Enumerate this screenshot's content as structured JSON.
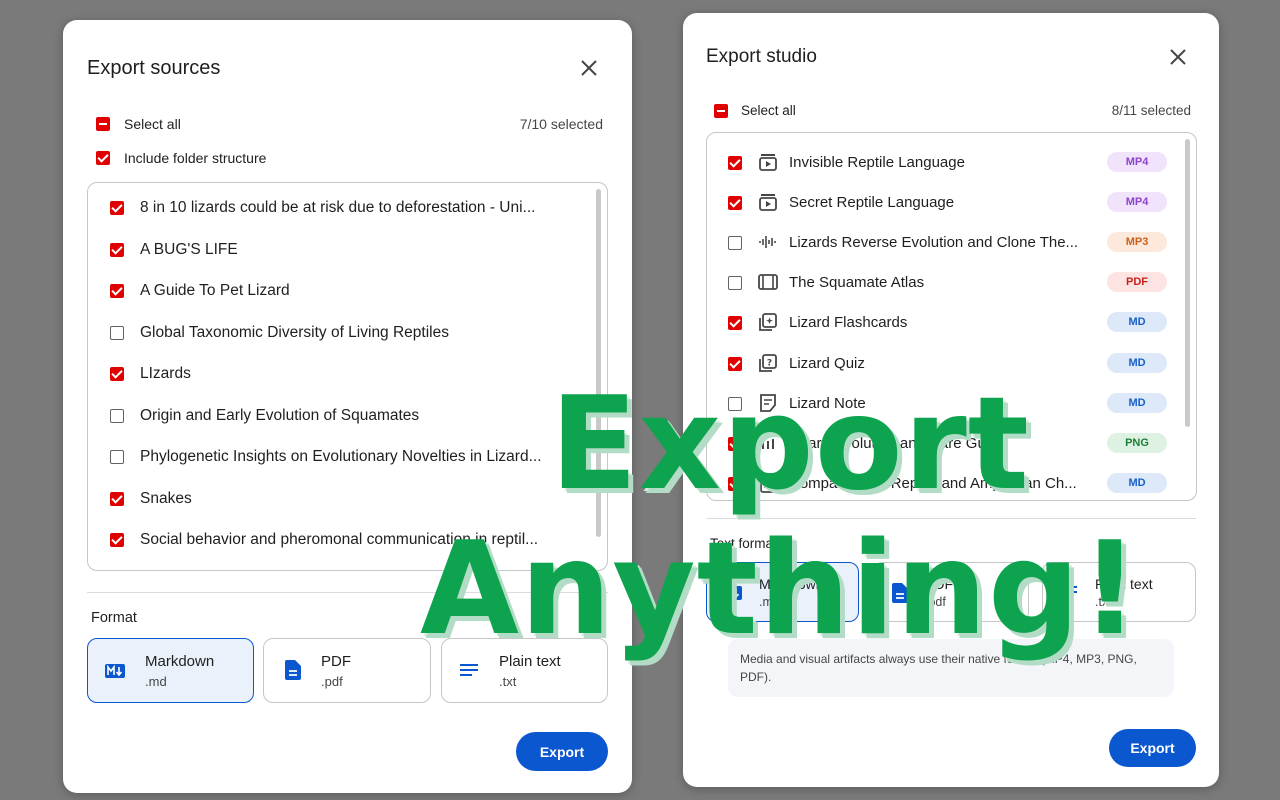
{
  "export_sources": {
    "title": "Export sources",
    "select_all_label": "Select all",
    "selected_count": "7/10 selected",
    "folder_structure_label": "Include folder structure",
    "items": [
      {
        "label": "8 in 10 lizards could be at risk due to deforestation - Uni...",
        "checked": true
      },
      {
        "label": "A BUG'S LIFE",
        "checked": true
      },
      {
        "label": "A Guide To Pet Lizard",
        "checked": true
      },
      {
        "label": "Global Taxonomic Diversity of Living Reptiles",
        "checked": false
      },
      {
        "label": "LIzards",
        "checked": true
      },
      {
        "label": "Origin and Early Evolution of Squamates",
        "checked": false
      },
      {
        "label": "Phylogenetic Insights on Evolutionary Novelties in Lizard...",
        "checked": false
      },
      {
        "label": "Snakes",
        "checked": true
      },
      {
        "label": "Social behavior and pheromonal communication in reptil...",
        "checked": true
      }
    ],
    "format_label": "Format",
    "formats": [
      {
        "name": "Markdown",
        "ext": ".md",
        "icon": "markdown-icon",
        "selected": true
      },
      {
        "name": "PDF",
        "ext": ".pdf",
        "icon": "pdf-doc-icon",
        "selected": false
      },
      {
        "name": "Plain text",
        "ext": ".txt",
        "icon": "text-lines-icon",
        "selected": false
      }
    ],
    "export_label": "Export"
  },
  "export_studio": {
    "title": "Export studio",
    "select_all_label": "Select all",
    "selected_count": "8/11 selected",
    "items": [
      {
        "label": "Invisible Reptile Language",
        "checked": true,
        "icon": "video-overview-icon",
        "badge": "MP4"
      },
      {
        "label": "Secret Reptile Language",
        "checked": true,
        "icon": "video-overview-icon",
        "badge": "MP4"
      },
      {
        "label": "Lizards Reverse Evolution and Clone The...",
        "checked": false,
        "icon": "audio-waveform-icon",
        "badge": "MP3"
      },
      {
        "label": "The Squamate Atlas",
        "checked": false,
        "icon": "slides-icon",
        "badge": "PDF"
      },
      {
        "label": "Lizard Flashcards",
        "checked": true,
        "icon": "flashcards-icon",
        "badge": "MD"
      },
      {
        "label": "Lizard Quiz",
        "checked": true,
        "icon": "quiz-icon",
        "badge": "MD"
      },
      {
        "label": "Lizard Note",
        "checked": false,
        "icon": "note-icon",
        "badge": "MD"
      },
      {
        "label": "Lizard Evolution and Care Guide",
        "checked": true,
        "icon": "infographic-icon",
        "badge": "PNG"
      },
      {
        "label": "Comparison of Reptile and Amphibian Ch...",
        "checked": true,
        "icon": "report-icon",
        "badge": "MD"
      }
    ],
    "text_format_label": "Text format",
    "formats": [
      {
        "name": "Markdown",
        "ext": ".md",
        "icon": "markdown-icon",
        "selected": true
      },
      {
        "name": "PDF",
        "ext": ".pdf",
        "icon": "pdf-doc-icon",
        "selected": false
      },
      {
        "name": "Plain text",
        "ext": ".txt",
        "icon": "text-lines-icon",
        "selected": false
      }
    ],
    "note": "Media and visual artifacts always use their native format (MP4, MP3, PNG, PDF).",
    "export_label": "Export"
  },
  "banner": {
    "line1": "Export",
    "line2": "Anything!"
  },
  "colors": {
    "checkbox": "#e00000",
    "primary": "#0b57d0",
    "banner_text": "#0ea34e",
    "badge_mp4_bg": "#f0e3fb",
    "badge_mp4_fg": "#8e44c9",
    "badge_mp3_bg": "#fde9dc",
    "badge_mp3_fg": "#c8611b",
    "badge_pdf_bg": "#fde3e1",
    "badge_pdf_fg": "#c5221f",
    "badge_md_bg": "#dde8f8",
    "badge_md_fg": "#1a5fc7",
    "badge_png_bg": "#ddf2e3",
    "badge_png_fg": "#1e7e34"
  }
}
